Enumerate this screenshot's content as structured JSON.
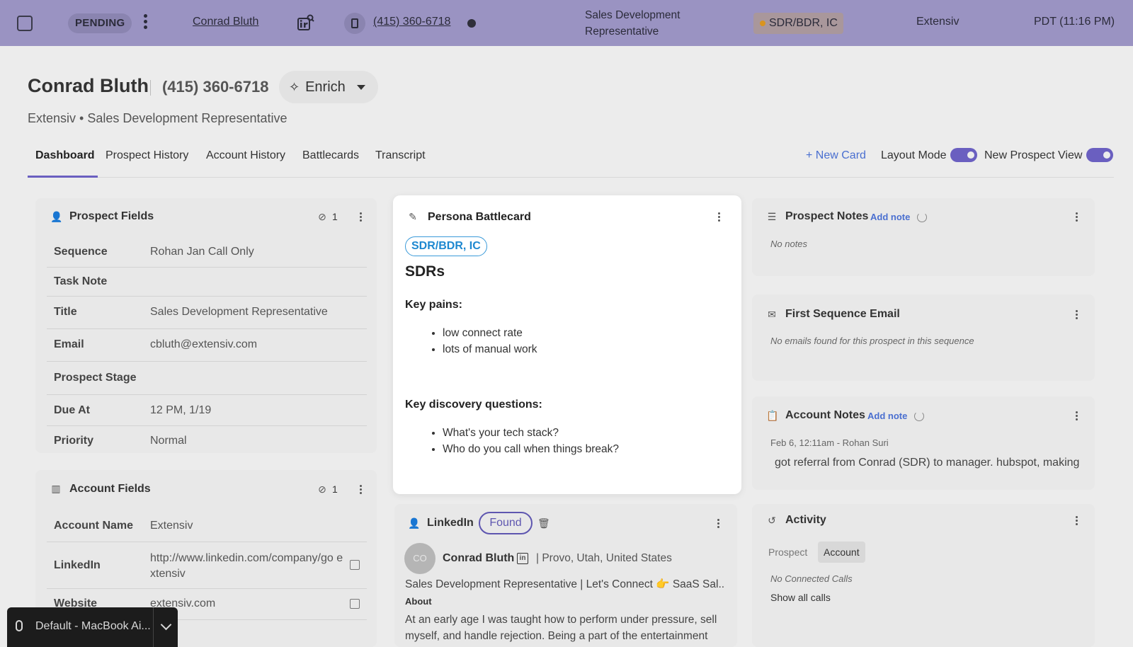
{
  "topbar": {
    "status": "PENDING",
    "name": "Conrad Bluth",
    "phone": "(415) 360-6718",
    "title": "Sales Development Representative",
    "persona": "SDR/BDR, IC",
    "company": "Extensiv",
    "time": "PDT (11:16 PM)"
  },
  "header": {
    "name": "Conrad Bluth",
    "phone": "(415) 360-6718",
    "enrich_label": "Enrich",
    "subtitle": "Extensiv • Sales Development Representative"
  },
  "tabs": [
    "Dashboard",
    "Prospect History",
    "Account History",
    "Battlecards",
    "Transcript"
  ],
  "active_tab": "Dashboard",
  "actions": {
    "new_card": "+ New Card",
    "layout_mode": "Layout Mode",
    "new_prospect_view": "New Prospect View",
    "layout_mode_on": true,
    "new_prospect_view_on": true
  },
  "prospect_fields": {
    "title": "Prospect Fields",
    "hidden_count": "1",
    "rows": [
      {
        "key": "Sequence",
        "value": "Rohan Jan Call Only"
      },
      {
        "key": "Task Note",
        "value": ""
      },
      {
        "key": "Title",
        "value": "Sales Development Representative"
      },
      {
        "key": "Email",
        "value": "cbluth@extensiv.com"
      },
      {
        "key": "Prospect Stage",
        "value": ""
      },
      {
        "key": "Due At",
        "value": "12 PM, 1/19"
      },
      {
        "key": "Priority",
        "value": "Normal"
      }
    ]
  },
  "account_fields": {
    "title": "Account Fields",
    "hidden_count": "1",
    "rows": [
      {
        "key": "Account Name",
        "value": "Extensiv"
      },
      {
        "key": "LinkedIn",
        "value": "http://www.linkedin.com/company/go extensiv"
      },
      {
        "key": "Website",
        "value": "extensiv.com"
      }
    ]
  },
  "battlecard": {
    "title": "Persona Battlecard",
    "badge": "SDR/BDR, IC",
    "heading": "SDRs",
    "pains_label": "Key pains:",
    "pains": [
      "low connect rate",
      "lots of manual work"
    ],
    "questions_label": "Key discovery questions:",
    "questions": [
      "What's your tech stack?",
      "Who do you call when things break?"
    ]
  },
  "linkedin": {
    "title": "LinkedIn",
    "status": "Found",
    "avatar_initials": "CO",
    "name": "Conrad Bluth",
    "location": "| Provo, Utah, United States",
    "headline": "Sales Development Representative | Let's Connect 👉 SaaS Sal...",
    "about_label": "About",
    "about": "At an early age I was taught how to perform under pressure, sell myself, and handle rejection. Being a part of the entertainment"
  },
  "prospect_notes": {
    "title": "Prospect Notes",
    "add_note": "Add note",
    "empty": "No notes"
  },
  "first_email": {
    "title": "First Sequence Email",
    "empty": "No emails found for this prospect in this sequence"
  },
  "account_notes": {
    "title": "Account Notes",
    "add_note": "Add note",
    "meta": "Feb 6, 12:11am - Rohan Suri",
    "text": "got referral from Conrad (SDR) to manager. hubspot, making"
  },
  "activity": {
    "title": "Activity",
    "tabs": [
      "Prospect",
      "Account"
    ],
    "active": "Account",
    "empty": "No Connected Calls",
    "show_all": "Show all calls"
  },
  "mic": {
    "device": "Default - MacBook Ai..."
  },
  "colors": {
    "topbar": "#9a93c2",
    "accent": "#6a5fc0",
    "link": "#4a6fd0",
    "badge_blue": "#1e88d0"
  }
}
